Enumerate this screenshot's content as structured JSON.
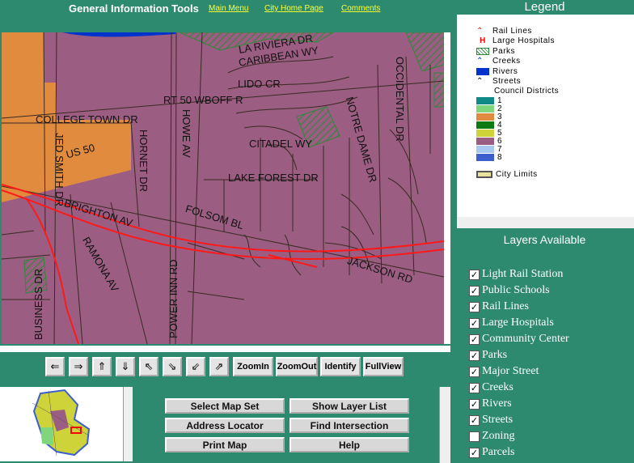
{
  "header": {
    "title": "General Information Tools",
    "links": [
      "Main Menu",
      "City Home Page",
      "Comments"
    ]
  },
  "map": {
    "street_labels": [
      "LA RIVIERA DR",
      "CARIBBEAN WY",
      "LIDO CR",
      "RT 50 WBOFF R",
      "OCCIDENTAL DR",
      "COLLEGE TOWN DR",
      "NOTRE DAME DR",
      "CITADEL WY",
      "US 50",
      "HORNET DR",
      "HOWE AV",
      "JED SMITH DR",
      "LAKE FOREST DR",
      "BRIGHTON AV",
      "FOLSOM BL",
      "RAMONA AV",
      "JACKSON RD",
      "BUSINESS DR",
      "POWER INN RD"
    ]
  },
  "toolbar": {
    "icon_buttons": [
      {
        "name": "pan-west-icon",
        "glyph": "⇐"
      },
      {
        "name": "pan-east-icon",
        "glyph": "⇒"
      },
      {
        "name": "pan-north-icon",
        "glyph": "⇑"
      },
      {
        "name": "pan-south-icon",
        "glyph": "⇓"
      },
      {
        "name": "pan-northwest-icon",
        "glyph": "⇖"
      },
      {
        "name": "pan-southeast-icon",
        "glyph": "⇘"
      },
      {
        "name": "pan-southwest-icon",
        "glyph": "⇙"
      },
      {
        "name": "pan-northeast-icon",
        "glyph": "⇗"
      }
    ],
    "zoom_in": "ZoomIn",
    "zoom_out": "ZoomOut",
    "identify": "Identify",
    "full_view": "FullView"
  },
  "controls": {
    "select_map_set": "Select Map Set",
    "show_layer_list": "Show Layer List",
    "address_locator": "Address Locator",
    "find_intersection": "Find Intersection",
    "print_map": "Print Map",
    "help": "Help"
  },
  "legend": {
    "title": "Legend",
    "rail_lines": "Rail Lines",
    "large_hospitals": "Large Hospitals",
    "parks": "Parks",
    "creeks": "Creeks",
    "rivers": "Rivers",
    "streets": "Streets",
    "council_districts": "Council Districts",
    "districts": [
      {
        "label": "1",
        "color": "#0f8a86"
      },
      {
        "label": "2",
        "color": "#7fd67d"
      },
      {
        "label": "3",
        "color": "#e08b3e"
      },
      {
        "label": "4",
        "color": "#0c7a12"
      },
      {
        "label": "5",
        "color": "#cfd33a"
      },
      {
        "label": "6",
        "color": "#9b5d82"
      },
      {
        "label": "7",
        "color": "#a8c8f0"
      },
      {
        "label": "8",
        "color": "#3c5ecf"
      }
    ],
    "city_limits": "City Limits",
    "city_limits_color": "#e8e29a"
  },
  "layers": {
    "title": "Layers Available",
    "items": [
      {
        "label": "Light Rail Station",
        "checked": true
      },
      {
        "label": "Public Schools",
        "checked": true
      },
      {
        "label": "Rail Lines",
        "checked": true
      },
      {
        "label": "Large Hospitals",
        "checked": true
      },
      {
        "label": "Community Center",
        "checked": true
      },
      {
        "label": "Parks",
        "checked": true
      },
      {
        "label": "Major Street",
        "checked": true
      },
      {
        "label": "Creeks",
        "checked": true
      },
      {
        "label": "Rivers",
        "checked": true
      },
      {
        "label": "Streets",
        "checked": true
      },
      {
        "label": "Zoning",
        "checked": false
      },
      {
        "label": "Parcels",
        "checked": true
      }
    ]
  }
}
